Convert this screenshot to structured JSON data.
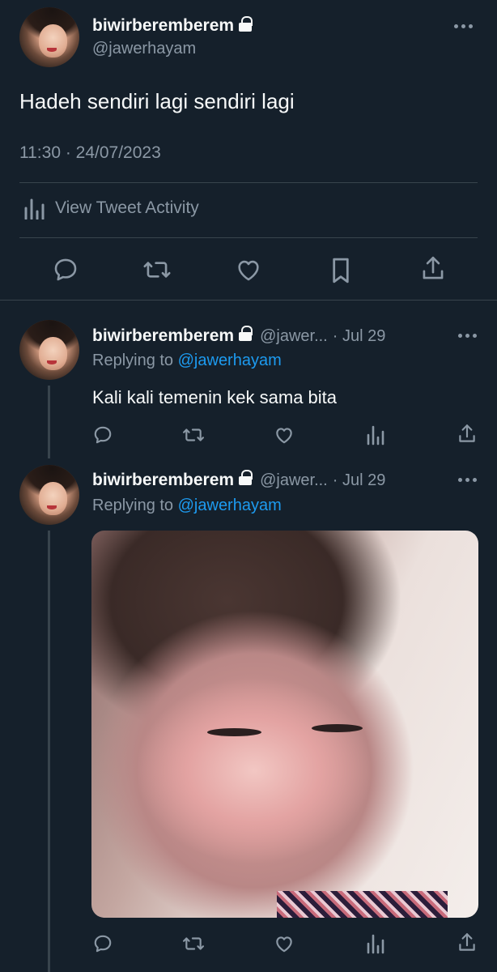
{
  "main_tweet": {
    "display_name": "biwirberemberem",
    "handle": "@jawerhayam",
    "text": "Hadeh sendiri lagi sendiri lagi",
    "timestamp": "11:30 · 24/07/2023",
    "activity_label": "View Tweet Activity",
    "actions": [
      "reply-icon",
      "retweet-icon",
      "like-icon",
      "bookmark-icon",
      "share-icon"
    ]
  },
  "replies": [
    {
      "display_name": "biwirberemberem",
      "handle_truncated": "@jawer...",
      "date": "· Jul 29",
      "replying_prefix": "Replying to",
      "replying_to": "@jawerhayam",
      "text": "Kali kali temenin kek sama bita",
      "has_media": false
    },
    {
      "display_name": "biwirberemberem",
      "handle_truncated": "@jawer...",
      "date": "· Jul 29",
      "replying_prefix": "Replying to",
      "replying_to": "@jawerhayam",
      "text": "",
      "has_media": true
    }
  ],
  "colors": {
    "background": "#15202b",
    "text_primary": "#f7f9f9",
    "text_secondary": "#8b98a5",
    "link": "#1d9bf0",
    "divider": "#38444d"
  }
}
